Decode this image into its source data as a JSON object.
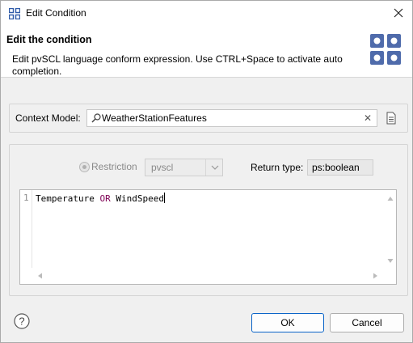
{
  "window": {
    "title": "Edit Condition"
  },
  "header": {
    "title": "Edit the condition",
    "description": "Edit pvSCL language conform expression. Use CTRL+Space to activate auto completion."
  },
  "context": {
    "label": "Context Model:",
    "value": "WeatherStationFeatures"
  },
  "expression": {
    "restriction_label": "Restriction",
    "language_value": "pvscl",
    "return_type_label": "Return type:",
    "return_type_value": "ps:boolean",
    "line_number": "1",
    "code_part1": "Temperature ",
    "code_keyword": "OR",
    "code_part2": " WindSpeed"
  },
  "buttons": {
    "ok": "OK",
    "cancel": "Cancel"
  },
  "colors": {
    "keyword": "#7f0055",
    "ok_border": "#0a64c8",
    "header_icon": "#4f6bab"
  }
}
